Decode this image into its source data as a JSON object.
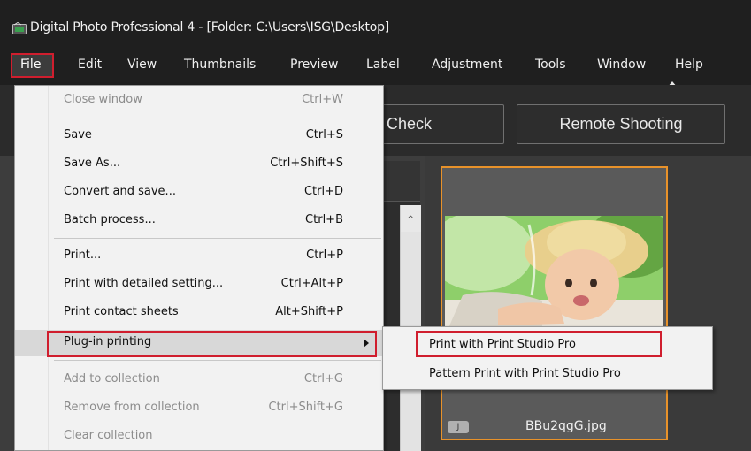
{
  "window": {
    "title": "Digital Photo Professional 4 - [Folder: C:\\Users\\ISG\\Desktop]"
  },
  "menubar": {
    "items": [
      "File",
      "Edit",
      "View",
      "Thumbnails",
      "Preview",
      "Label",
      "Adjustment",
      "Tools",
      "Window",
      "Help"
    ]
  },
  "toolbar": {
    "check_label": "Check",
    "remote_label": "Remote Shooting"
  },
  "file_menu": {
    "items": [
      {
        "label": "Close window",
        "shortcut": "Ctrl+W",
        "disabled": true
      },
      {
        "label": "Save",
        "shortcut": "Ctrl+S"
      },
      {
        "label": "Save As...",
        "shortcut": "Ctrl+Shift+S"
      },
      {
        "label": "Convert and save...",
        "shortcut": "Ctrl+D"
      },
      {
        "label": "Batch process...",
        "shortcut": "Ctrl+B"
      },
      {
        "label": "Print...",
        "shortcut": "Ctrl+P"
      },
      {
        "label": "Print with detailed setting...",
        "shortcut": "Ctrl+Alt+P"
      },
      {
        "label": "Print contact sheets",
        "shortcut": "Alt+Shift+P"
      },
      {
        "label": "Plug-in printing",
        "shortcut": ""
      },
      {
        "label": "Add to collection",
        "shortcut": "Ctrl+G",
        "disabled": true
      },
      {
        "label": "Remove from collection",
        "shortcut": "Ctrl+Shift+G",
        "disabled": true
      },
      {
        "label": "Clear collection",
        "shortcut": "",
        "disabled": true
      }
    ]
  },
  "submenu": {
    "items": [
      "Print with Print Studio Pro",
      "Pattern Print with Print Studio Pro"
    ]
  },
  "thumbnail": {
    "badge": "J",
    "filename": "BBu2qgG.jpg"
  },
  "colors": {
    "highlight_border": "#d01e2e",
    "thumb_border": "#e8922a"
  }
}
